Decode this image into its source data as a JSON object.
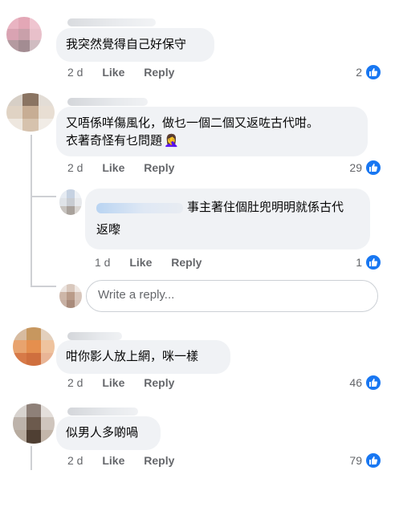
{
  "comments": [
    {
      "text_lines": [
        "我突然覺得自己好保守"
      ],
      "time": "2 d",
      "like_label": "Like",
      "reply_label": "Reply",
      "reactions": "2"
    },
    {
      "text_lines": [
        "又唔係咩傷風化，做乜一個二個又返咗古代咁。",
        "衣著奇怪有乜問題"
      ],
      "emoji": "🤦‍♀️",
      "time": "2 d",
      "like_label": "Like",
      "reply_label": "Reply",
      "reactions": "29"
    },
    {
      "text_lines": [
        "咁你影人放上網，咪一樣"
      ],
      "time": "2 d",
      "like_label": "Like",
      "reply_label": "Reply",
      "reactions": "46"
    },
    {
      "text_lines": [
        "似男人多啲喎"
      ],
      "time": "2 d",
      "like_label": "Like",
      "reply_label": "Reply",
      "reactions": "79"
    }
  ],
  "reply": {
    "text_line1": "事主著住個肚兜明明就係古代",
    "text_line2": "返嚟",
    "time": "1 d",
    "like_label": "Like",
    "reply_label": "Reply",
    "reactions": "1"
  },
  "reply_input": {
    "placeholder": "Write a reply..."
  },
  "icons": {
    "reaction": "thumbs-up-icon"
  },
  "colors": {
    "like_blue": "#1877f2",
    "bubble_bg": "#f0f2f5",
    "meta_gray": "#65676b"
  }
}
